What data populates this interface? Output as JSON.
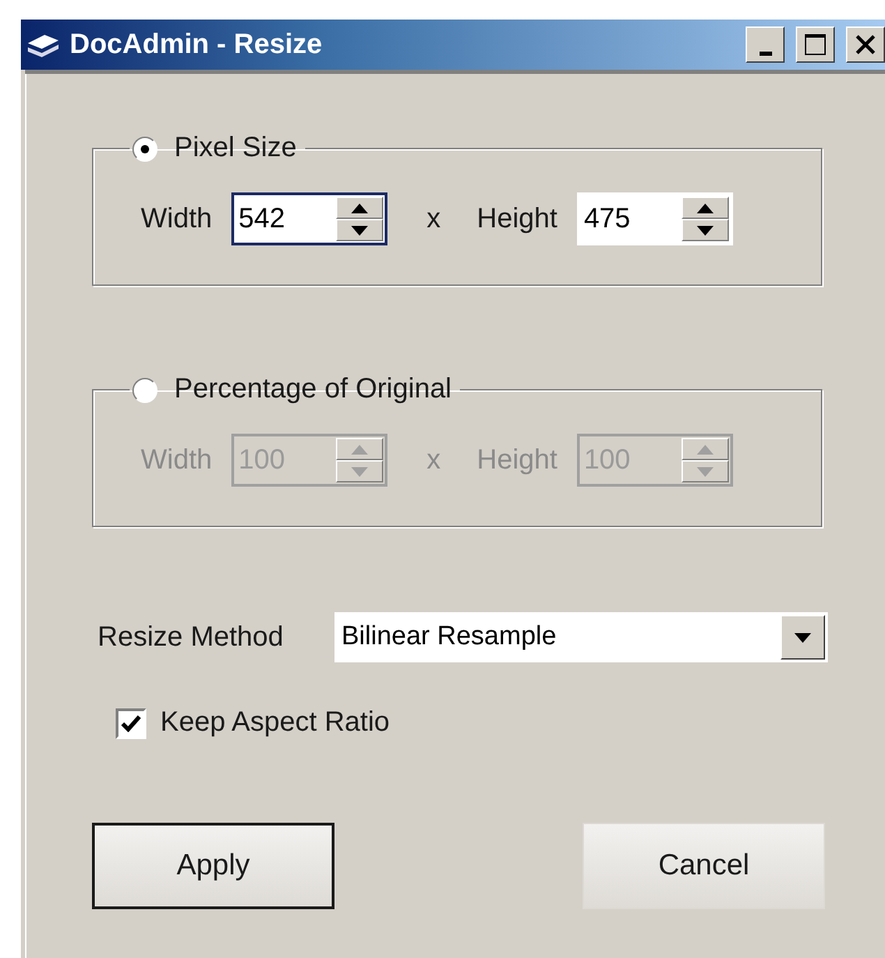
{
  "window": {
    "title": "DocAdmin - Resize"
  },
  "groups": [
    {
      "label": "Pixel Size",
      "selected": true,
      "disabled": false,
      "width_label": "Width",
      "width": {
        "value": "542",
        "focused": true
      },
      "separator": "x",
      "height_label": "Height",
      "height": {
        "value": "475",
        "focused": false
      }
    },
    {
      "label": "Percentage of Original",
      "selected": false,
      "disabled": true,
      "width_label": "Width",
      "width": {
        "value": "100",
        "focused": false
      },
      "separator": "x",
      "height_label": "Height",
      "height": {
        "value": "100",
        "focused": false
      }
    }
  ],
  "resize_method": {
    "label": "Resize Method",
    "value": "Bilinear Resample"
  },
  "keep_aspect_ratio": {
    "label": "Keep Aspect Ratio",
    "checked": true
  },
  "buttons": [
    {
      "label": "Apply",
      "default": true
    },
    {
      "label": "Cancel",
      "default": false
    }
  ]
}
